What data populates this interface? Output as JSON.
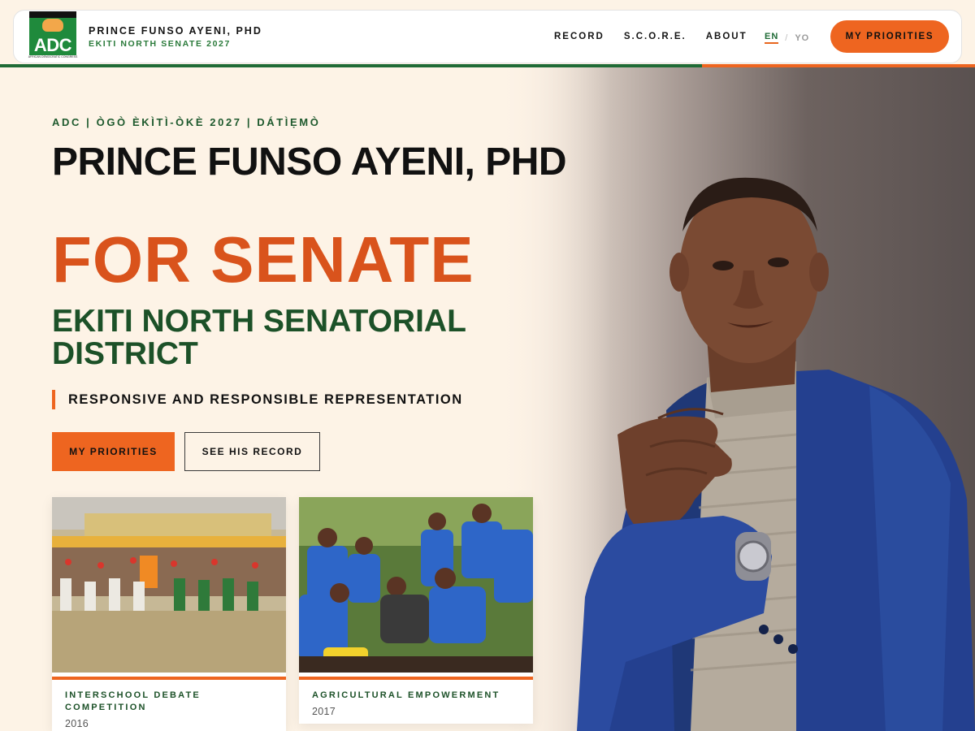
{
  "header": {
    "logo_text": "ADC",
    "logo_subtext": "AFRICAN DEMOCRATIC CONGRESS",
    "brand_name": "PRINCE FUNSO AYENI, PHD",
    "brand_subtitle": "EKITI NORTH SENATE 2027",
    "nav": [
      {
        "label": "RECORD"
      },
      {
        "label": "S.C.O.R.E."
      },
      {
        "label": "ABOUT"
      }
    ],
    "lang": {
      "active": "EN",
      "separator": "/",
      "other": "YO"
    },
    "cta_label": "MY PRIORITIES"
  },
  "hero": {
    "kicker": "ADC | ÒGÒ ÈKÌTÌ-ÒKÈ 2027 | DÁTÌẸMÒ",
    "name": "PRINCE FUNSO AYENI, PHD",
    "headline": "FOR SENATE",
    "district": "EKITI NORTH SENATORIAL DISTRICT",
    "tagline": "RESPONSIVE AND RESPONSIBLE REPRESENTATION",
    "primary_button": "MY PRIORITIES",
    "secondary_button": "SEE HIS RECORD"
  },
  "cards": [
    {
      "title": "INTERSCHOOL DEBATE COMPETITION",
      "year": "2016"
    },
    {
      "title": "AGRICULTURAL EMPOWERMENT",
      "year": "2017"
    }
  ],
  "colors": {
    "accent_orange": "#ee6520",
    "brand_green": "#1c5128",
    "headline_orange": "#d9531c",
    "background_cream": "#fdf3e6"
  }
}
